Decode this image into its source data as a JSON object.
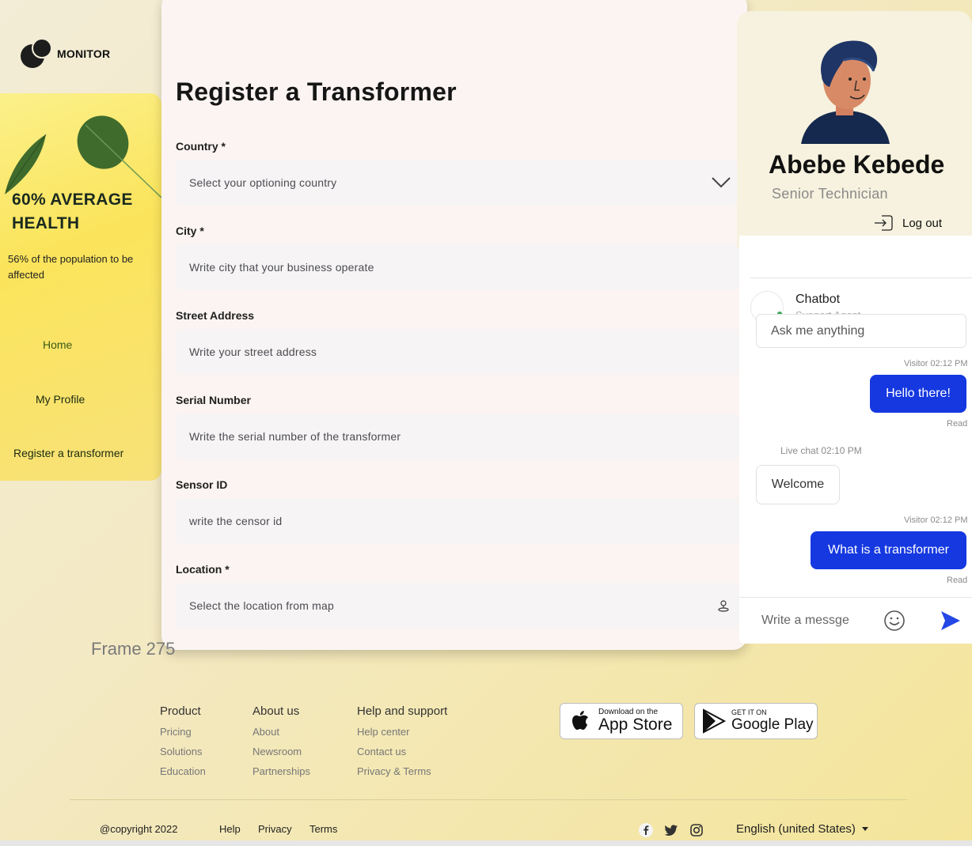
{
  "brand": {
    "name": "MONITOR"
  },
  "sidebar": {
    "headline": "60% AVERAGE HEALTH",
    "subtext": "56% of the population to be affected",
    "nav": [
      {
        "label": "Home"
      },
      {
        "label": "My Profile"
      },
      {
        "label": "Register a transformer"
      }
    ]
  },
  "form": {
    "title": "Register a Transformer",
    "fields": [
      {
        "label": "Country *",
        "placeholder": "Select your optioning country",
        "icon": "chevron-down-icon"
      },
      {
        "label": "City *",
        "placeholder": "Write city that your business operate"
      },
      {
        "label": "Street Address",
        "placeholder": "Write your street address"
      },
      {
        "label": "Serial Number",
        "placeholder": "Write the serial number of the transformer"
      },
      {
        "label": "Sensor ID",
        "placeholder": "write the censor id"
      },
      {
        "label": "Location *",
        "placeholder": "Select the location from map",
        "icon": "map-pin-icon"
      }
    ]
  },
  "frame_label": "Frame 275",
  "profile": {
    "name": "Abebe Kebede",
    "role": "Senior Technician",
    "logout": "Log out"
  },
  "chat": {
    "agent_name": "Chatbot",
    "agent_role": "Support Agent",
    "ask_placeholder": "Ask me anything",
    "messages": [
      {
        "meta": "Visitor 02:12 PM",
        "text": "Hello there!",
        "status": "Read"
      },
      {
        "meta": "Live chat 02:10 PM",
        "text": "Welcome"
      },
      {
        "meta": "Visitor 02:12 PM",
        "text": "What is a transformer",
        "status": "Read"
      }
    ],
    "compose_placeholder": "Write a messge"
  },
  "footer": {
    "columns": [
      {
        "title": "Product",
        "links": [
          "Pricing",
          "Solutions",
          "Education"
        ]
      },
      {
        "title": "About us",
        "links": [
          "About",
          "Newsroom",
          "Partnerships"
        ]
      },
      {
        "title": "Help and support",
        "links": [
          "Help center",
          "Contact us",
          "Privacy & Terms"
        ]
      }
    ],
    "app_store": {
      "small": "Download on the",
      "big": "App Store"
    },
    "google_play": {
      "small": "GET IT ON",
      "big": "Google Play"
    },
    "copyright": "@copyright 2022",
    "bottom_links": [
      "Help",
      "Privacy",
      "Terms"
    ],
    "social": [
      "facebook-icon",
      "twitter-icon",
      "instagram-icon"
    ],
    "language": "English (united States)"
  }
}
